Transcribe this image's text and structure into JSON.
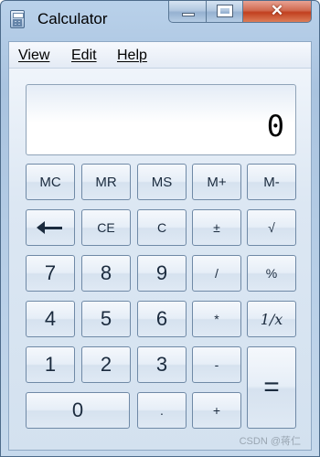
{
  "window": {
    "title": "Calculator",
    "close_glyph": "✕"
  },
  "menu": {
    "items": [
      "View",
      "Edit",
      "Help"
    ]
  },
  "display": {
    "value": "0"
  },
  "keys": {
    "mc": "MC",
    "mr": "MR",
    "ms": "MS",
    "m_plus": "M+",
    "m_minus": "M-",
    "backspace_icon": "backspace-arrow-icon",
    "ce": "CE",
    "c": "C",
    "plus_minus": "±",
    "sqrt": "√",
    "seven": "7",
    "eight": "8",
    "nine": "9",
    "divide": "/",
    "percent": "%",
    "four": "4",
    "five": "5",
    "six": "6",
    "multiply": "*",
    "reciprocal": "1/x",
    "one": "1",
    "two": "2",
    "three": "3",
    "subtract": "-",
    "equals": "=",
    "zero": "0",
    "decimal": ".",
    "add": "+"
  },
  "watermark": "CSDN @蒋仁",
  "colors": {
    "frame": "#b9d1ea",
    "close_button": "#c2401f",
    "key_text": "#1b2b3e"
  }
}
